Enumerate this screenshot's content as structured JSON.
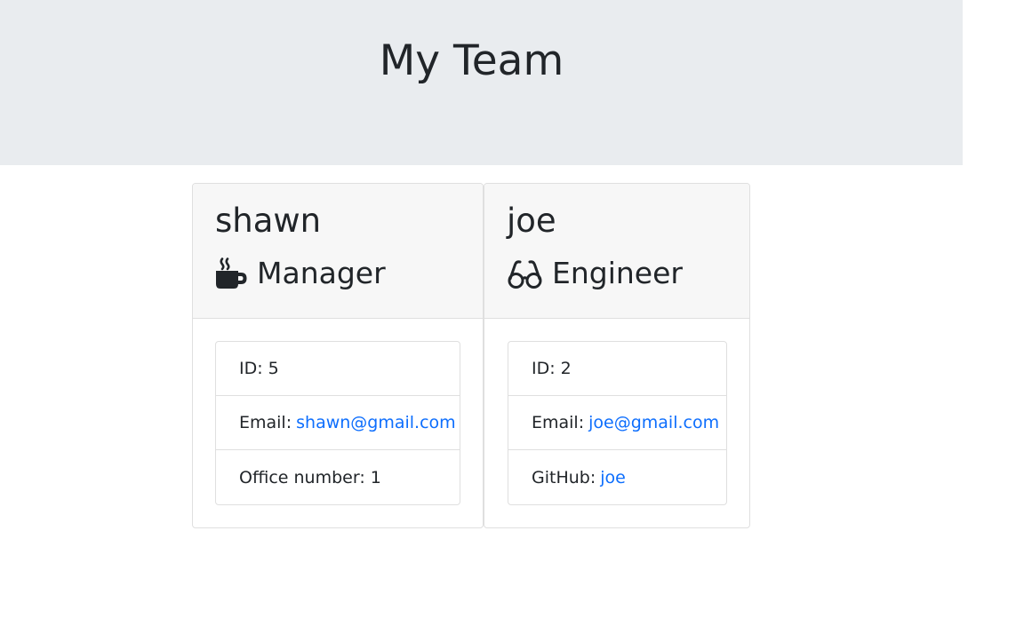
{
  "header": {
    "title": "My Team"
  },
  "team": [
    {
      "name": "shawn",
      "role": "Manager",
      "role_icon": "coffee-mug-icon",
      "id_text": "ID: 5",
      "email_label": "Email:",
      "email": "shawn@gmail.com",
      "extra_label": "Office number: 1"
    },
    {
      "name": "joe",
      "role": "Engineer",
      "role_icon": "glasses-icon",
      "id_text": "ID: 2",
      "email_label": "Email:",
      "email": "joe@gmail.com",
      "extra_label": "GitHub:",
      "extra_link": "joe"
    }
  ],
  "colors": {
    "header_bg": "#e9ecef",
    "card_header_bg": "#f7f7f7",
    "link": "#0d6efd",
    "text": "#212529",
    "border": "#dfdfdf"
  }
}
